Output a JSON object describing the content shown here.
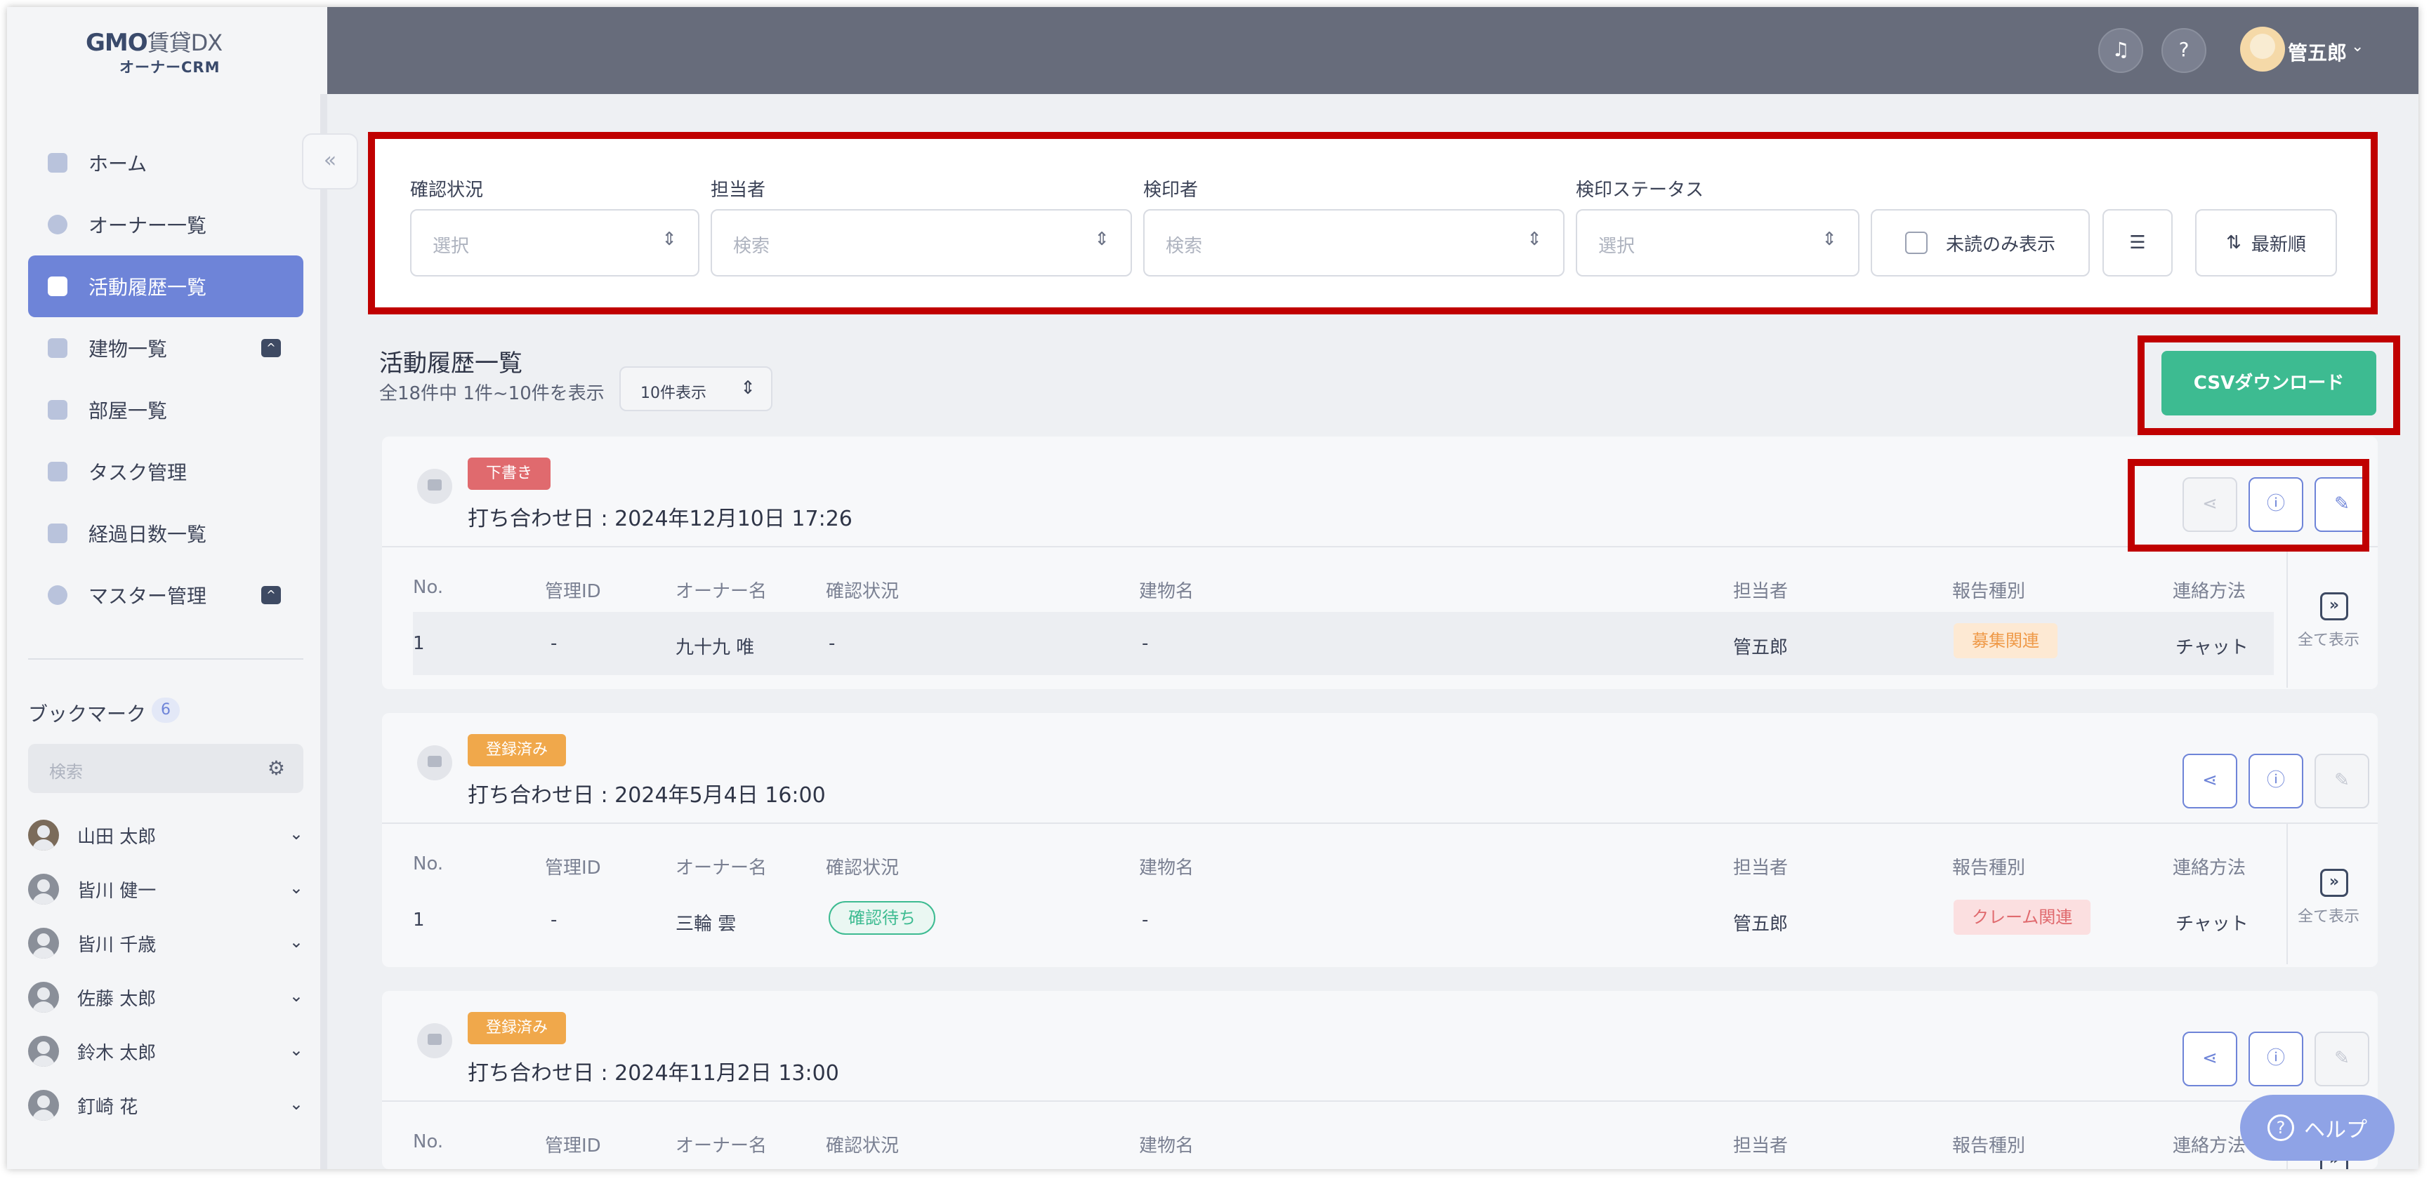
{
  "logo": {
    "brand": "GMO",
    "product": "賃貸DX",
    "sub": "オーナーCRM"
  },
  "nav": [
    {
      "label": "ホーム"
    },
    {
      "label": "オーナー一覧"
    },
    {
      "label": "活動履歴一覧",
      "active": true
    },
    {
      "label": "建物一覧",
      "badge": "^"
    },
    {
      "label": "部屋一覧"
    },
    {
      "label": "タスク管理"
    },
    {
      "label": "経過日数一覧"
    },
    {
      "label": "マスター管理",
      "badge": "^"
    }
  ],
  "bookmarks": {
    "title": "ブックマーク",
    "count": "6",
    "search_placeholder": "検索",
    "items": [
      {
        "name": "山田 太郎"
      },
      {
        "name": "皆川 健一"
      },
      {
        "name": "皆川 千歳"
      },
      {
        "name": "佐藤 太郎"
      },
      {
        "name": "鈴木 太郎"
      },
      {
        "name": "釘崎 花"
      }
    ]
  },
  "header": {
    "user_name": "管五郎",
    "bell_icon": "bell-icon",
    "help_icon": "question-icon"
  },
  "filters": {
    "confirm_status": {
      "label": "確認状況",
      "placeholder": "選択"
    },
    "assignee": {
      "label": "担当者",
      "placeholder": "検索"
    },
    "approver": {
      "label": "検印者",
      "placeholder": "検索"
    },
    "approval_status": {
      "label": "検印ステータス",
      "placeholder": "選択"
    },
    "unread_only": "未読のみ表示",
    "sort": "最新順"
  },
  "list": {
    "title": "活動履歴一覧",
    "count_text": "全18件中 1件~10件を表示",
    "per_page": "10件表示",
    "csv_button": "CSVダウンロード"
  },
  "columns": [
    "No.",
    "管理ID",
    "オーナー名",
    "確認状況",
    "建物名",
    "担当者",
    "報告種別",
    "連絡方法"
  ],
  "show_all": "全て表示",
  "cards": [
    {
      "status": "下書き",
      "status_type": "draft",
      "date": "打ち合わせ日 : 2024年12月10日 17:26",
      "row": {
        "no": "1",
        "id": "-",
        "owner": "九十九 唯",
        "confirm": "-",
        "building": "-",
        "assignee": "管五郎",
        "report": "募集関連",
        "report_type": "recruit",
        "contact": "チャット"
      }
    },
    {
      "status": "登録済み",
      "status_type": "done",
      "date": "打ち合わせ日 : 2024年5月4日 16:00",
      "row": {
        "no": "1",
        "id": "-",
        "owner": "三輪 雲",
        "confirm": "確認待ち",
        "building": "-",
        "assignee": "管五郎",
        "report": "クレーム関連",
        "report_type": "claim",
        "contact": "チャット"
      }
    },
    {
      "status": "登録済み",
      "status_type": "done",
      "date": "打ち合わせ日 : 2024年11月2日 13:00"
    }
  ],
  "help_button": "ヘルプ"
}
